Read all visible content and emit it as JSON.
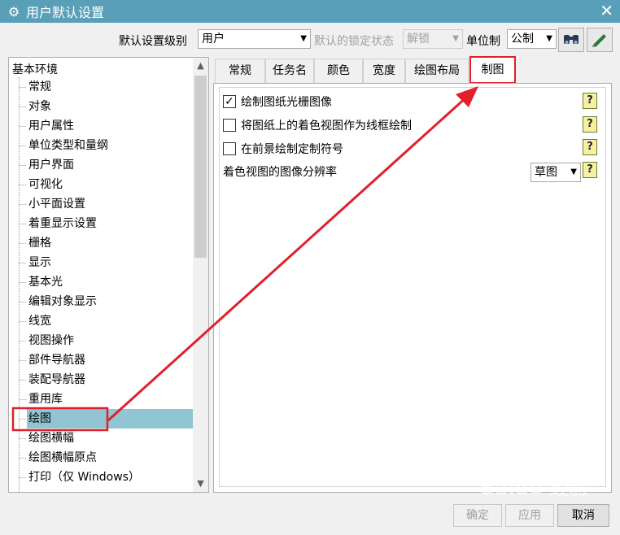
{
  "window": {
    "title": "用户默认设置",
    "close": "✕",
    "app_icon": "⚙"
  },
  "toolbar": {
    "level_label": "默认设置级别",
    "level_value": "用户",
    "lock_label": "默认的锁定状态",
    "lock_value": "解锁",
    "unit_label": "单位制",
    "unit_value": "公制",
    "icons": [
      "binoculars-icon",
      "edit-icon"
    ]
  },
  "tree": {
    "root": "基本环境",
    "items": [
      "常规",
      "对象",
      "用户属性",
      "单位类型和量纲",
      "用户界面",
      "可视化",
      "小平面设置",
      "着重显示设置",
      "栅格",
      "显示",
      "基本光",
      "编辑对象显示",
      "线宽",
      "视图操作",
      "部件导航器",
      "装配导航器",
      "重用库",
      "绘图",
      "绘图横幅",
      "绘图横幅原点",
      "打印（仅 Windows）"
    ],
    "selected_index": 17
  },
  "tabs": [
    "常规",
    "任务名",
    "颜色",
    "宽度",
    "绘图布局",
    "制图"
  ],
  "active_tab": 5,
  "options": {
    "opt1": {
      "label": "绘制图纸光栅图像",
      "checked": true
    },
    "opt2": {
      "label": "将图纸上的着色视图作为线框绘制",
      "checked": false
    },
    "opt3": {
      "label": "在前景绘制定制符号",
      "checked": false
    },
    "resolution_label": "着色视图的图像分辨率",
    "resolution_value": "草图",
    "help": "?"
  },
  "buttons": {
    "ok": "确定",
    "apply": "应用",
    "cancel": "取消"
  },
  "watermark": "Baidu 经验",
  "highlight_color": "#e0202a"
}
